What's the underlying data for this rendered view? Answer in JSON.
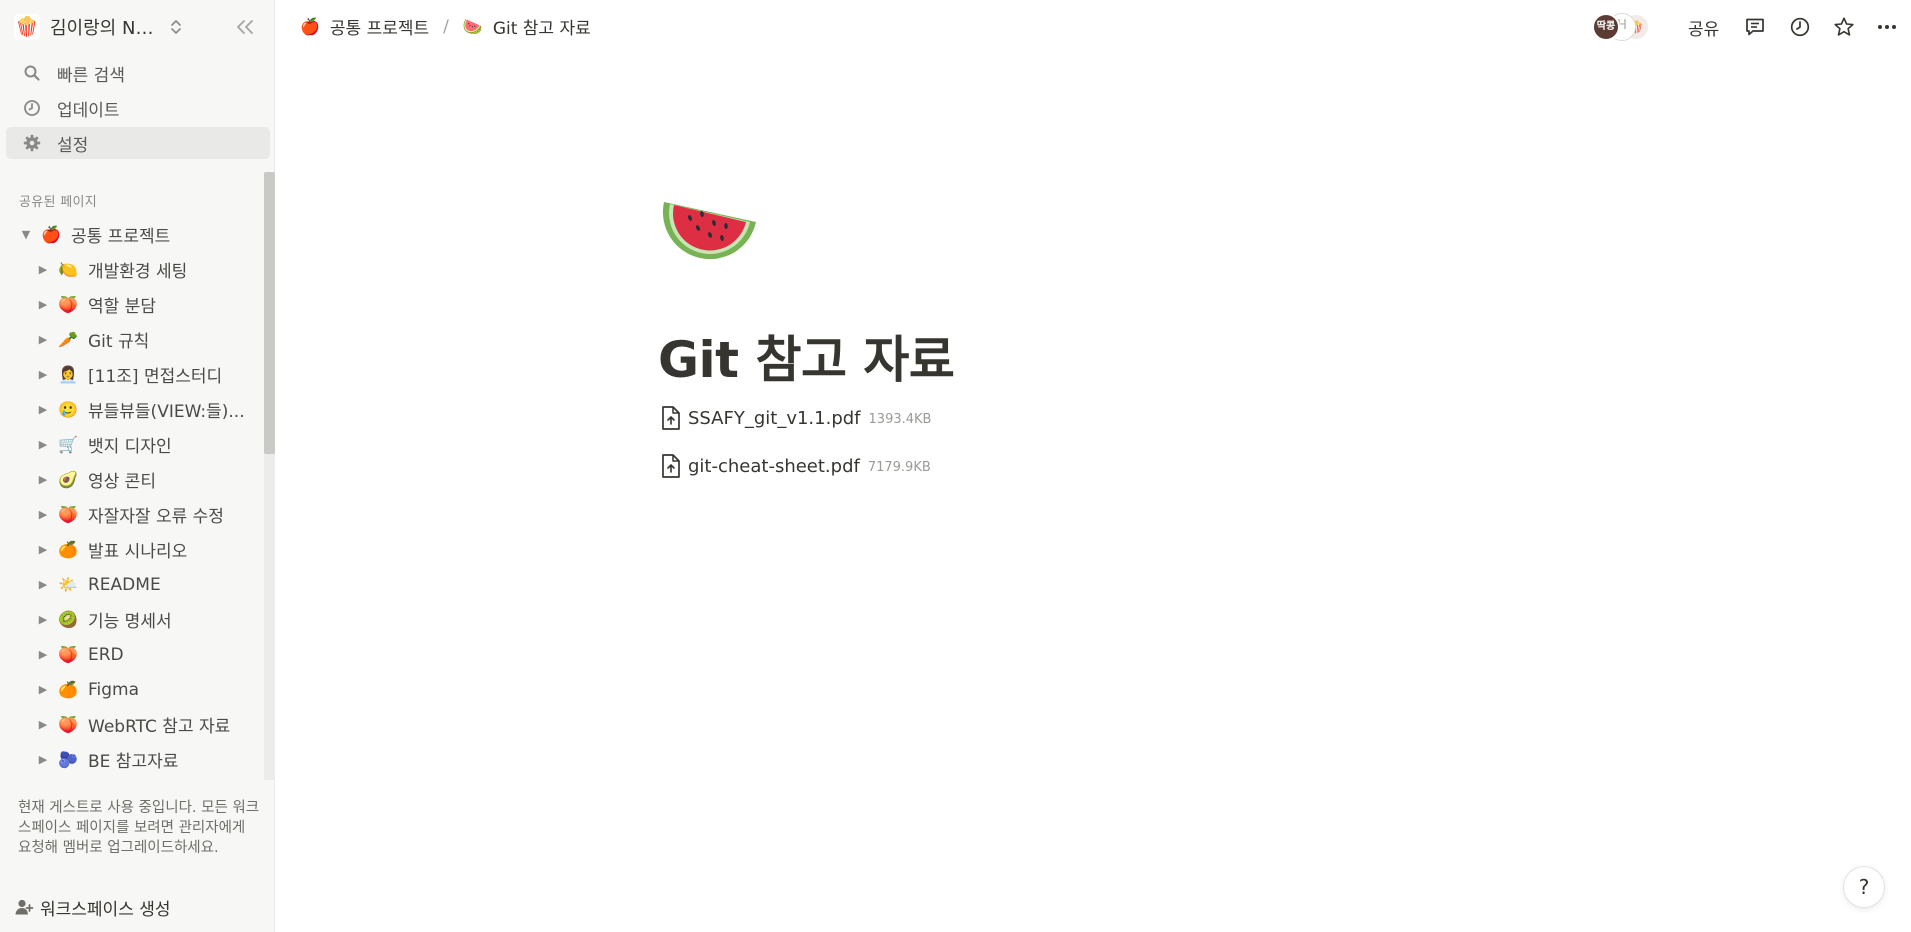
{
  "workspace": {
    "name": "김이랑의 Not...",
    "logo_icon": "popcorn-emoji"
  },
  "nav": {
    "search_label": "빠른 검색",
    "updates_label": "업데이트",
    "settings_label": "설정"
  },
  "sidebar": {
    "section_label": "공유된 페이지",
    "root": {
      "emoji": "🍎",
      "label": "공통 프로젝트"
    },
    "items": [
      {
        "emoji": "🍋",
        "label": "개발환경 세팅"
      },
      {
        "emoji": "🍑",
        "label": "역할 분담"
      },
      {
        "emoji": "🥕",
        "label": "Git 규칙"
      },
      {
        "emoji": "👩‍💼",
        "label": "[11조] 면접스터디"
      },
      {
        "emoji": "🥲",
        "label": "뷰들뷰들(VIEW:들)..."
      },
      {
        "emoji": "🛒",
        "label": "뱃지 디자인"
      },
      {
        "emoji": "🥑",
        "label": "영상 콘티"
      },
      {
        "emoji": "🍑",
        "label": "자잘자잘 오류 수정"
      },
      {
        "emoji": "🍊",
        "label": "발표 시나리오"
      },
      {
        "emoji": "🌤️",
        "label": "README"
      },
      {
        "emoji": "🥝",
        "label": "기능 명세서"
      },
      {
        "emoji": "🍑",
        "label": "ERD"
      },
      {
        "emoji": "🍊",
        "label": "Figma"
      },
      {
        "emoji": "🍑",
        "label": "WebRTC 참고 자료"
      },
      {
        "emoji": "🫐",
        "label": "BE 참고자료"
      }
    ],
    "guest_note": "현재 게스트로 사용 중입니다. 모든 워크스페이스 페이지를 보려면 관리자에게 요청해 멤버로 업그레이드하세요.",
    "create_workspace_label": "워크스페이스 생성"
  },
  "topbar": {
    "breadcrumbs": [
      {
        "emoji": "🍎",
        "label": "공통 프로젝트"
      },
      {
        "emoji": "🍉",
        "label": "Git 참고 자료"
      }
    ],
    "separator": "/",
    "avatars": [
      "딱콩",
      "H",
      "🍿"
    ],
    "share_label": "공유"
  },
  "page": {
    "icon": "watermelon-emoji",
    "title": "Git 참고 자료",
    "files": [
      {
        "name": "SSAFY_git_v1.1.pdf",
        "size": "1393.4KB"
      },
      {
        "name": "git-cheat-sheet.pdf",
        "size": "7179.9KB"
      }
    ]
  },
  "help_label": "?"
}
